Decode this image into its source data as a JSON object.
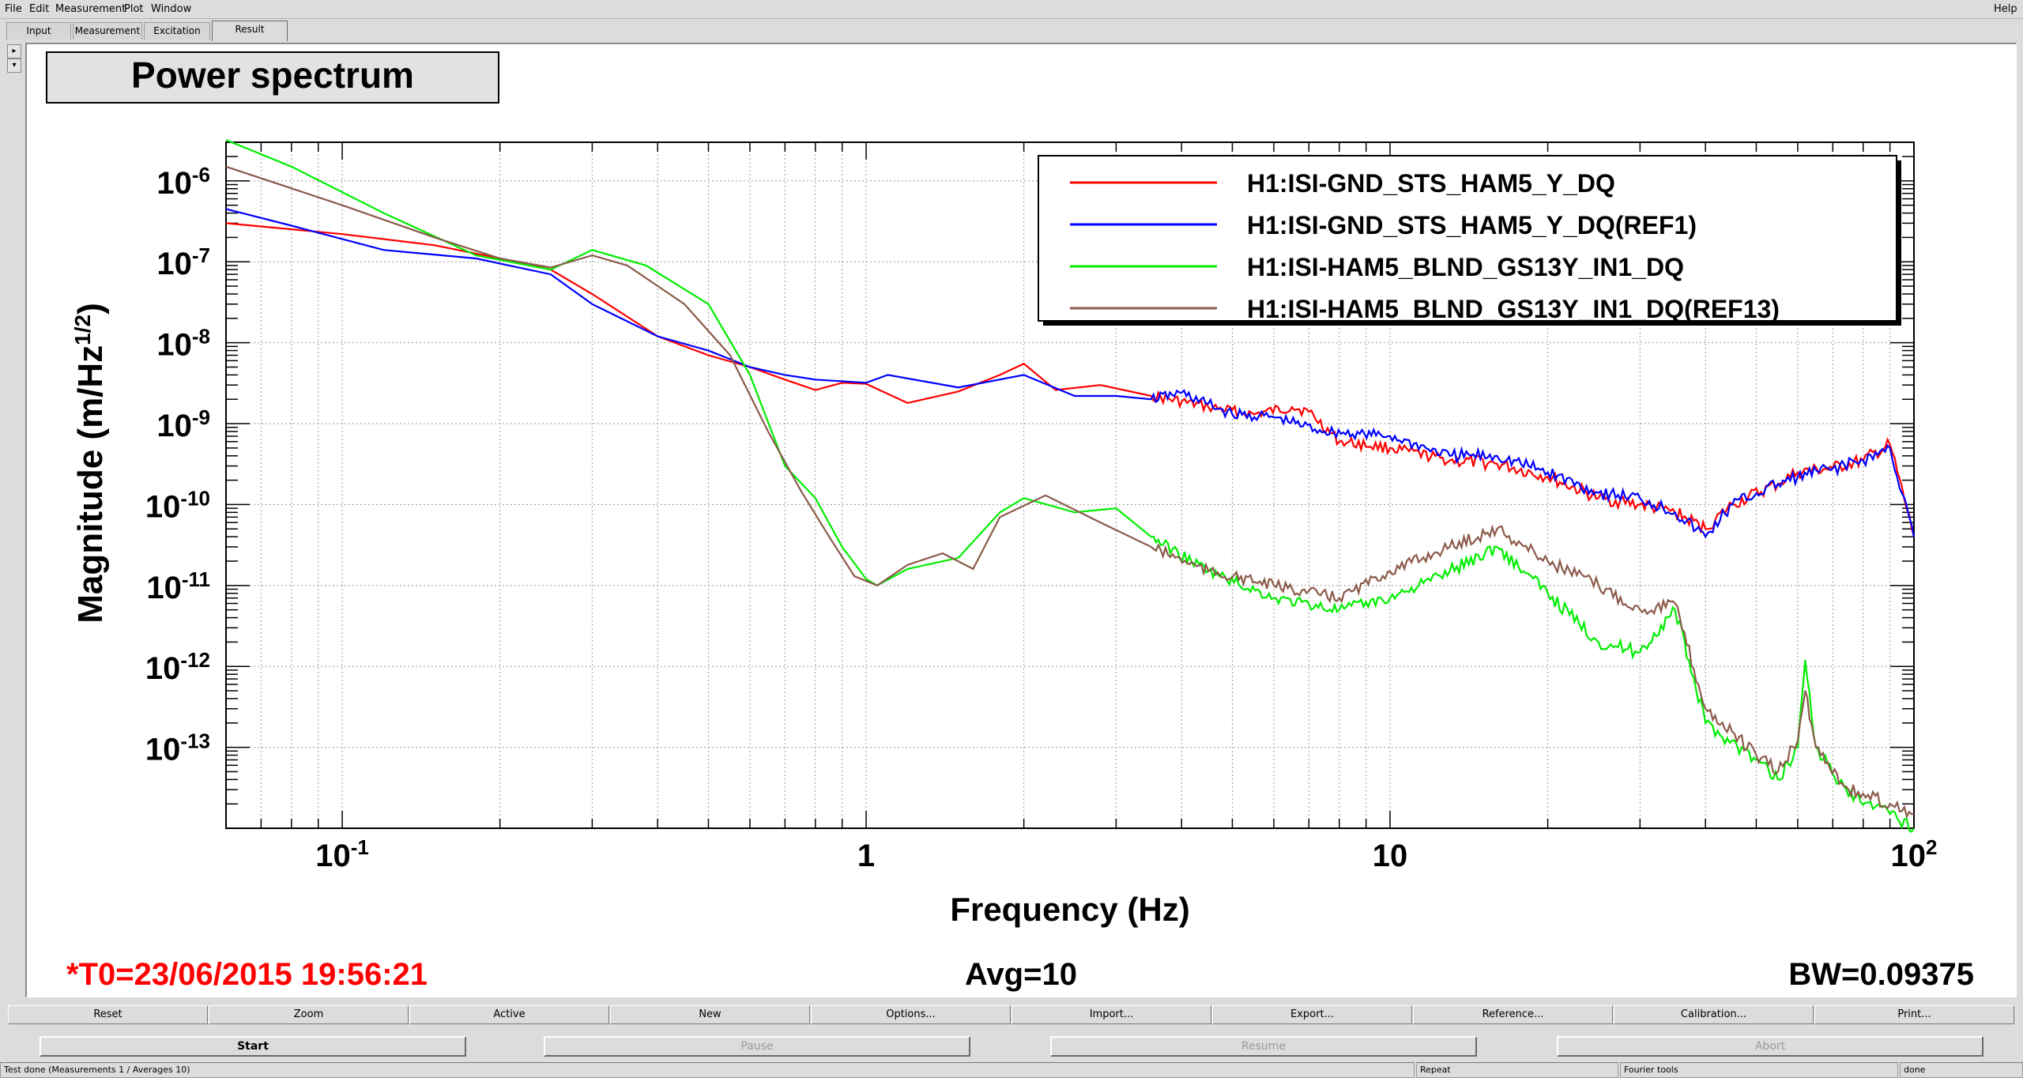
{
  "menu": {
    "items": [
      {
        "label": "File",
        "x": 6
      },
      {
        "label": "Edit",
        "x": 37
      },
      {
        "label": "Measurement",
        "x": 70
      },
      {
        "label": "Plot",
        "x": 157
      },
      {
        "label": "Window",
        "x": 191
      }
    ],
    "help": "Help"
  },
  "tabs": [
    {
      "label": "Input"
    },
    {
      "label": "Measurement"
    },
    {
      "label": "Excitation"
    },
    {
      "label": "Result",
      "active": true
    }
  ],
  "plot": {
    "title": "Power spectrum",
    "t0": "*T0=23/06/2015 19:56:21",
    "avg": "Avg=10",
    "bw": "BW=0.09375",
    "colors": {
      "red": "#ff0000",
      "blue": "#0000ff",
      "green": "#00ee00",
      "brown": "#8b5a4a",
      "t0": "#ff0000"
    }
  },
  "chart_data": {
    "type": "line",
    "title": "Power spectrum",
    "xlabel": "Frequency (Hz)",
    "ylabel": "Magnitude (m/Hz^1/2)",
    "xscale": "log",
    "yscale": "log",
    "xlim": [
      0.06,
      100
    ],
    "ylim": [
      1e-14,
      3e-06
    ],
    "xtick_labels": [
      "10^-1",
      "1",
      "10",
      "10^2"
    ],
    "ytick_labels": [
      "10^-13",
      "10^-12",
      "10^-11",
      "10^-10",
      "10^-9",
      "10^-8",
      "10^-7",
      "10^-6"
    ],
    "grid": true,
    "legend_position": "top-right",
    "series": [
      {
        "name": "H1:ISI-GND_STS_HAM5_Y_DQ",
        "color": "#ff0000",
        "points": [
          [
            0.06,
            3e-07
          ],
          [
            0.1,
            2.2e-07
          ],
          [
            0.15,
            1.6e-07
          ],
          [
            0.2,
            1.1e-07
          ],
          [
            0.25,
            8e-08
          ],
          [
            0.3,
            4e-08
          ],
          [
            0.4,
            1.2e-08
          ],
          [
            0.5,
            7e-09
          ],
          [
            0.6,
            5e-09
          ],
          [
            0.7,
            3.5e-09
          ],
          [
            0.8,
            2.6e-09
          ],
          [
            0.9,
            3.2e-09
          ],
          [
            1.0,
            3.1e-09
          ],
          [
            1.2,
            1.8e-09
          ],
          [
            1.5,
            2.5e-09
          ],
          [
            1.8,
            4e-09
          ],
          [
            2.0,
            5.5e-09
          ],
          [
            2.3,
            2.6e-09
          ],
          [
            2.8,
            3e-09
          ],
          [
            3.5,
            2.2e-09
          ],
          [
            4.5,
            1.6e-09
          ],
          [
            5.5,
            1.3e-09
          ],
          [
            6.5,
            1.6e-09
          ],
          [
            7.0,
            1.4e-09
          ],
          [
            8.0,
            6e-10
          ],
          [
            10,
            5e-10
          ],
          [
            13,
            3.5e-10
          ],
          [
            16,
            3.2e-10
          ],
          [
            20,
            2.2e-10
          ],
          [
            25,
            1.2e-10
          ],
          [
            30,
            1e-10
          ],
          [
            35,
            8e-11
          ],
          [
            40,
            5e-11
          ],
          [
            45,
            1e-10
          ],
          [
            55,
            1.8e-10
          ],
          [
            60,
            2.5e-10
          ],
          [
            70,
            2.8e-10
          ],
          [
            80,
            3.5e-10
          ],
          [
            90,
            5.5e-10
          ],
          [
            100,
            4e-11
          ]
        ]
      },
      {
        "name": "H1:ISI-GND_STS_HAM5_Y_DQ(REF1)",
        "color": "#0000ff",
        "points": [
          [
            0.06,
            4.5e-07
          ],
          [
            0.08,
            2.8e-07
          ],
          [
            0.12,
            1.4e-07
          ],
          [
            0.18,
            1.1e-07
          ],
          [
            0.25,
            7e-08
          ],
          [
            0.3,
            3e-08
          ],
          [
            0.4,
            1.2e-08
          ],
          [
            0.5,
            8e-09
          ],
          [
            0.6,
            5e-09
          ],
          [
            0.7,
            4e-09
          ],
          [
            0.8,
            3.5e-09
          ],
          [
            1.0,
            3.2e-09
          ],
          [
            1.1,
            4e-09
          ],
          [
            1.5,
            2.8e-09
          ],
          [
            2.0,
            4e-09
          ],
          [
            2.5,
            2.2e-09
          ],
          [
            3.0,
            2.2e-09
          ],
          [
            3.5,
            2e-09
          ],
          [
            4.0,
            2.4e-09
          ],
          [
            5.0,
            1.3e-09
          ],
          [
            6.0,
            1.2e-09
          ],
          [
            7.5,
            8e-10
          ],
          [
            10,
            7e-10
          ],
          [
            13,
            4e-10
          ],
          [
            16,
            4e-10
          ],
          [
            20,
            2.5e-10
          ],
          [
            25,
            1.4e-10
          ],
          [
            30,
            1.2e-10
          ],
          [
            35,
            8e-11
          ],
          [
            40,
            4e-11
          ],
          [
            45,
            1e-10
          ],
          [
            55,
            1.8e-10
          ],
          [
            60,
            2.2e-10
          ],
          [
            70,
            2.8e-10
          ],
          [
            80,
            3.5e-10
          ],
          [
            90,
            5e-10
          ],
          [
            100,
            4e-11
          ]
        ]
      },
      {
        "name": "H1:ISI-HAM5_BLND_GS13Y_IN1_DQ",
        "color": "#00ee00",
        "points": [
          [
            0.06,
            3.2e-06
          ],
          [
            0.08,
            1.5e-06
          ],
          [
            0.12,
            4e-07
          ],
          [
            0.18,
            1.2e-07
          ],
          [
            0.25,
            8e-08
          ],
          [
            0.3,
            1.4e-07
          ],
          [
            0.38,
            9e-08
          ],
          [
            0.5,
            3e-08
          ],
          [
            0.6,
            4e-09
          ],
          [
            0.7,
            3e-10
          ],
          [
            0.8,
            1.2e-10
          ],
          [
            0.9,
            3e-11
          ],
          [
            1.0,
            1.2e-11
          ],
          [
            1.05,
            1e-11
          ],
          [
            1.2,
            1.6e-11
          ],
          [
            1.5,
            2.2e-11
          ],
          [
            1.8,
            8e-11
          ],
          [
            2.0,
            1.2e-10
          ],
          [
            2.5,
            8e-11
          ],
          [
            3.0,
            9e-11
          ],
          [
            3.5,
            4e-11
          ],
          [
            4.5,
            1.5e-11
          ],
          [
            6.0,
            7e-12
          ],
          [
            8.0,
            5e-12
          ],
          [
            10,
            7e-12
          ],
          [
            13,
            1.5e-11
          ],
          [
            16,
            3e-11
          ],
          [
            20,
            8e-12
          ],
          [
            25,
            2e-12
          ],
          [
            30,
            1.5e-12
          ],
          [
            35,
            5e-12
          ],
          [
            40,
            2e-13
          ],
          [
            50,
            7e-14
          ],
          [
            55,
            4e-14
          ],
          [
            60,
            1e-13
          ],
          [
            62,
            1.2e-12
          ],
          [
            65,
            1e-13
          ],
          [
            75,
            2.5e-14
          ],
          [
            90,
            1.5e-14
          ],
          [
            100,
            1e-14
          ]
        ]
      },
      {
        "name": "H1:ISI-HAM5_BLND_GS13Y_IN1_DQ(REF13)",
        "color": "#8b5a4a",
        "points": [
          [
            0.06,
            1.5e-06
          ],
          [
            0.1,
            5e-07
          ],
          [
            0.15,
            2e-07
          ],
          [
            0.2,
            1.1e-07
          ],
          [
            0.25,
            8.5e-08
          ],
          [
            0.3,
            1.2e-07
          ],
          [
            0.35,
            9e-08
          ],
          [
            0.45,
            3e-08
          ],
          [
            0.55,
            7e-09
          ],
          [
            0.65,
            8e-10
          ],
          [
            0.75,
            1.5e-10
          ],
          [
            0.85,
            4e-11
          ],
          [
            0.95,
            1.3e-11
          ],
          [
            1.05,
            1e-11
          ],
          [
            1.2,
            1.8e-11
          ],
          [
            1.4,
            2.5e-11
          ],
          [
            1.6,
            1.6e-11
          ],
          [
            1.8,
            7e-11
          ],
          [
            2.2,
            1.3e-10
          ],
          [
            2.8,
            6e-11
          ],
          [
            3.5,
            3e-11
          ],
          [
            4.5,
            1.5e-11
          ],
          [
            6,
            1e-11
          ],
          [
            8,
            7e-12
          ],
          [
            10,
            1.5e-11
          ],
          [
            13,
            3e-11
          ],
          [
            16,
            5e-11
          ],
          [
            20,
            2e-11
          ],
          [
            25,
            1e-11
          ],
          [
            30,
            5e-12
          ],
          [
            35,
            6e-12
          ],
          [
            40,
            3e-13
          ],
          [
            50,
            8e-14
          ],
          [
            55,
            5e-14
          ],
          [
            60,
            1.2e-13
          ],
          [
            62,
            5e-13
          ],
          [
            65,
            1e-13
          ],
          [
            75,
            3e-14
          ],
          [
            90,
            2e-14
          ],
          [
            100,
            1.5e-14
          ]
        ]
      }
    ]
  },
  "buttons_row1": [
    "Reset",
    "Zoom",
    "Active",
    "New",
    "Options...",
    "Import...",
    "Export...",
    "Reference...",
    "Calibration...",
    "Print..."
  ],
  "buttons_row2": [
    {
      "label": "Start",
      "enabled": true
    },
    {
      "label": "Pause",
      "enabled": false
    },
    {
      "label": "Resume",
      "enabled": false
    },
    {
      "label": "Abort",
      "enabled": false
    }
  ],
  "status": {
    "left": "Test done (Measurements 1 / Averages 10)",
    "repeat": "Repeat",
    "fourier": "Fourier tools",
    "state": "done"
  }
}
